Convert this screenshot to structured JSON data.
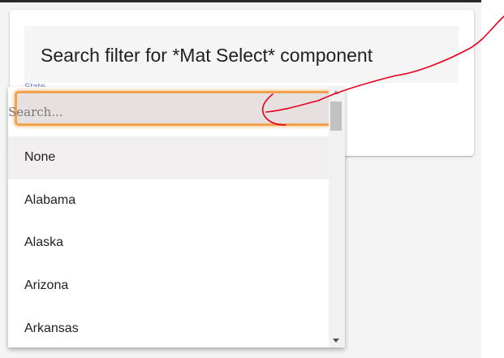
{
  "card": {
    "title": "Search filter for *Mat Select* component",
    "field_label": "State"
  },
  "search": {
    "placeholder": "Search...",
    "value": ""
  },
  "options": [
    {
      "label": "None",
      "selected": true
    },
    {
      "label": "Alabama",
      "selected": false
    },
    {
      "label": "Alaska",
      "selected": false
    },
    {
      "label": "Arizona",
      "selected": false
    },
    {
      "label": "Arkansas",
      "selected": false
    }
  ],
  "colors": {
    "search_highlight": "#f0a24c",
    "annotation_stroke": "#e8001c",
    "label_color": "#6f7fbf"
  },
  "icons": {
    "scroll_up": "arrow-up-icon",
    "scroll_down": "arrow-down-icon",
    "annotation": "red-arrow-annotation"
  }
}
